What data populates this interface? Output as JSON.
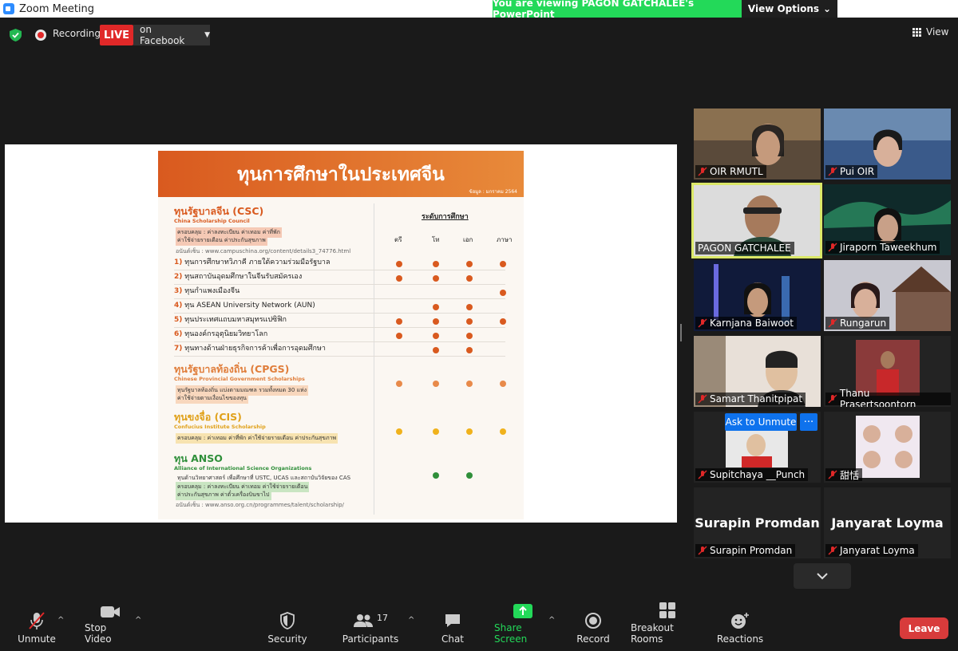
{
  "window": {
    "title": "Zoom Meeting"
  },
  "banner": {
    "viewing": "You are viewing PAGON GATCHALEE's PowerPoint",
    "view_options": "View Options"
  },
  "top": {
    "recording": "Recording",
    "live": "LIVE",
    "on_facebook": "on Facebook",
    "view": "View"
  },
  "slide": {
    "title": "ทุนการศึกษาในประเทศจีน",
    "source": "ข้อมูล : มกราคม 2564",
    "level_title": "ระดับการศึกษา",
    "levels": [
      "ตรี",
      "โท",
      "เอก",
      "ภาษา"
    ],
    "csc": {
      "title": "ทุนรัฐบาลจีน (CSC)",
      "sub": "China Scholarship Council",
      "cover1": "ครอบคลุม : ค่าลงทะเบียน ค่าเทอม ค่าที่พัก",
      "cover2": "ค่าใช้จ่ายรายเดือน ค่าประกันสุขภาพ",
      "url": "อนันต์เซ็น : www.campuschina.org/content/details3_74776.html",
      "rows": [
        {
          "num": "1)",
          "text": "ทุนการศึกษาทวิภาคี ภายใต้ความร่วมมือรัฐบาล"
        },
        {
          "num": "2)",
          "text": "ทุนสถาบันอุดมศึกษาในจีนรับสมัครเอง"
        },
        {
          "num": "3)",
          "text": "ทุนกำแพงเมืองจีน"
        },
        {
          "num": "4)",
          "text": "ทุน ASEAN University Network (AUN)"
        },
        {
          "num": "5)",
          "text": "ทุนประเทศแถบมหาสมุทรแปซิฟิก"
        },
        {
          "num": "6)",
          "text": "ทุนองค์กรอุตุนิยมวิทยาโลก"
        },
        {
          "num": "7)",
          "text": "ทุนทางด้านฝ่ายธุรกิจการค้าเพื่อการอุดมศึกษา"
        }
      ]
    },
    "cpgs": {
      "title": "ทุนรัฐบาลท้องถิ่น (CPGS)",
      "sub": "Chinese Provincial Government Scholarships",
      "cover1": "ทุนรัฐบาลท้องถิ่น แบ่งตามมณฑล รวมทั้งหมด 30 แห่ง",
      "cover2": "ค่าใช้จ่ายตามเงื่อนไขของทุน"
    },
    "cis": {
      "title": "ทุนขงจื่อ (CIS)",
      "sub": "Confucius Institute Scholarship",
      "cover1": "ครอบคลุม : ค่าเทอม ค่าที่พัก ค่าใช้จ่ายรายเดือน ค่าประกันสุขภาพ"
    },
    "anso": {
      "title": "ทุน ANSO",
      "sub": "Alliance of International Science Organizations",
      "line1": "ทุนด้านวิทยาศาสตร์ เพื่อศึกษาที่ USTC, UCAS และสถาบันวิจัยของ CAS",
      "cover1": "ครอบคลุม : ค่าลงทะเบียน ค่าเทอม ค่าใช้จ่ายรายเดือน",
      "cover2": "ค่าประกันสุขภาพ ค่าตั๋วเครื่องบินขาไป",
      "url": "อนันต์เซ็น : www.anso.org.cn/programmes/talent/scholarship/"
    }
  },
  "participants_panel": {
    "tiles": [
      {
        "name": "OIR RMUTL"
      },
      {
        "name": "Pui OIR"
      },
      {
        "name": "PAGON GATCHALEE"
      },
      {
        "name": "Jiraporn Taweekhum"
      },
      {
        "name": "Karnjana Baiwoot"
      },
      {
        "name": "Rungarun"
      },
      {
        "name": "Samart Thanitpipat"
      },
      {
        "name": "Thanu Prasertsoontorn"
      },
      {
        "name": "Supitchaya __Punch"
      },
      {
        "name": "甜恬"
      },
      {
        "name": "Surapin Promdan",
        "big": "Surapin Promdan"
      },
      {
        "name": "Janyarat Loyma",
        "big": "Janyarat Loyma"
      }
    ],
    "ask_to_unmute": "Ask to Unmute",
    "more": "···"
  },
  "toolbar": {
    "unmute": "Unmute",
    "stop_video": "Stop Video",
    "security": "Security",
    "participants": "Participants",
    "participants_count": "17",
    "chat": "Chat",
    "share_screen": "Share Screen",
    "record": "Record",
    "breakout_rooms": "Breakout Rooms",
    "reactions": "Reactions",
    "leave": "Leave"
  },
  "colors": {
    "accent_green": "#23d959",
    "live_red": "#e02828",
    "active_border": "#dbe868",
    "blue": "#0e72ed",
    "slide_orange": "#d95a1f"
  }
}
